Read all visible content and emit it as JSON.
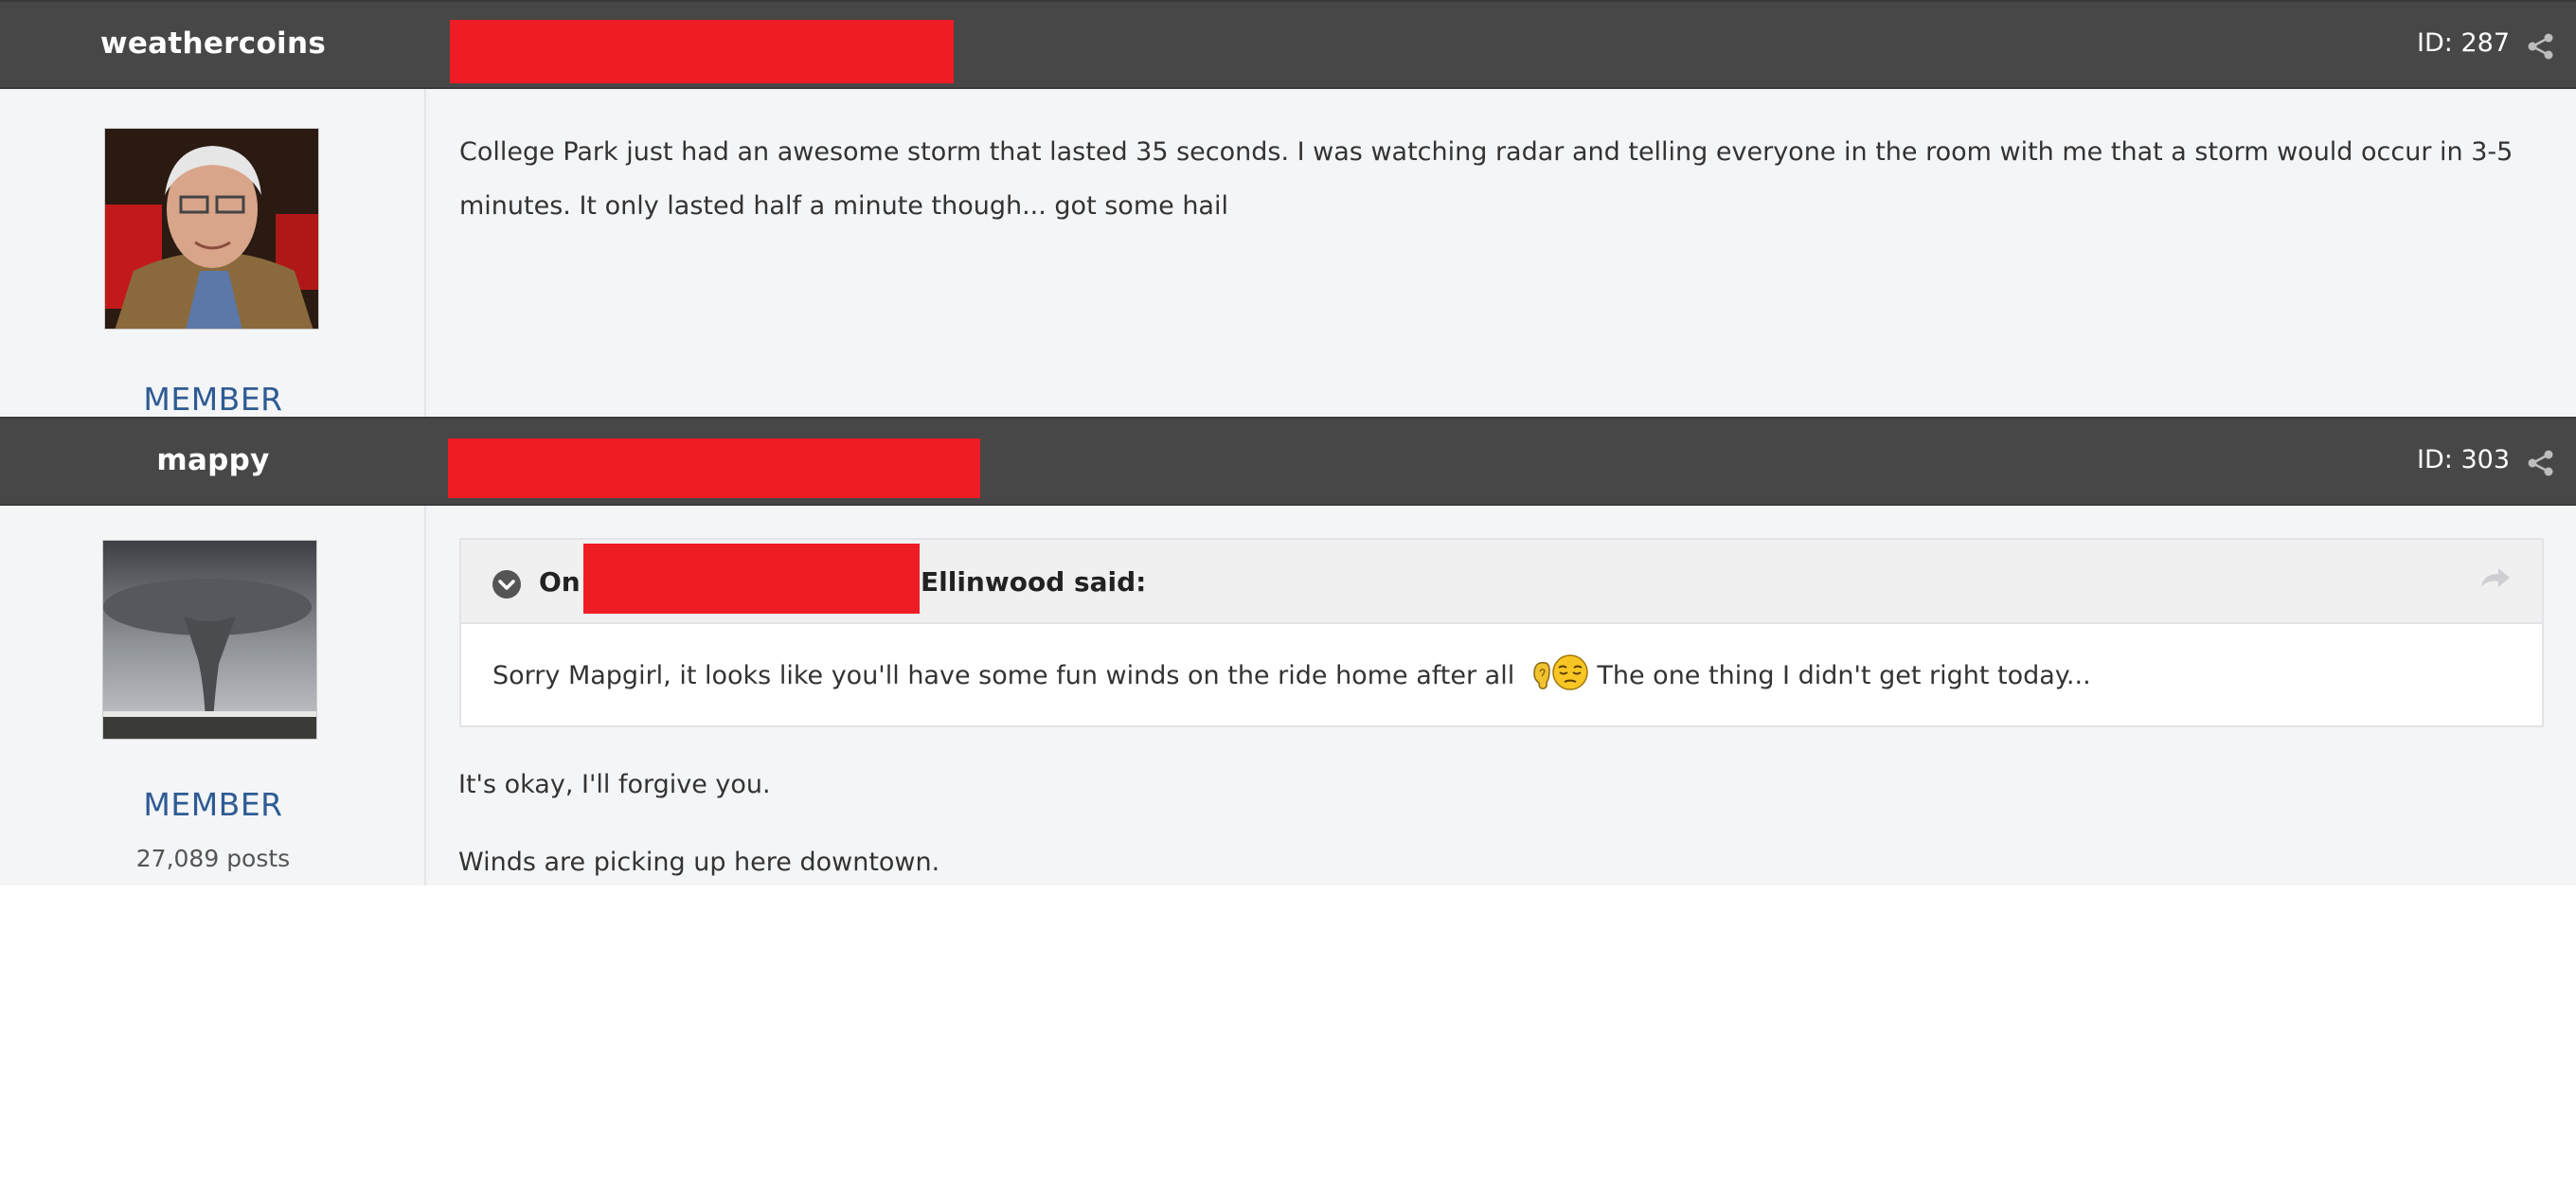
{
  "posts": [
    {
      "author": "weathercoins",
      "id_label": "ID: 287",
      "member_title": "MEMBER",
      "content_lines": [
        "College Park just had an awesome storm that lasted 35 seconds. I was watching radar and telling everyone in the room with me that a storm would occur in 3-5",
        "minutes. It only lasted half a minute though... got some hail"
      ]
    },
    {
      "author": "mappy",
      "id_label": "ID: 303",
      "member_title": "MEMBER",
      "post_count": "27,089 posts",
      "quote": {
        "prefix": "On",
        "suffix": "Ellinwood said:",
        "text_before_emoji": "Sorry Mapgirl, it looks like you'll have some fun winds on the ride home after all",
        "text_after_emoji": " The one thing I didn't get right today..."
      },
      "content_lines": [
        "It's okay, I'll forgive you.",
        "Winds are picking up here downtown."
      ]
    }
  ],
  "colors": {
    "header_bg": "#474747",
    "body_bg": "#f4f5f7",
    "member_title": "#2e5b93",
    "redaction": "#ee1c24"
  },
  "icons": [
    "share-icon",
    "chevron-down-icon",
    "reply-arrow-icon",
    "ear-emoji-icon",
    "sleepy-face-emoji-icon"
  ]
}
